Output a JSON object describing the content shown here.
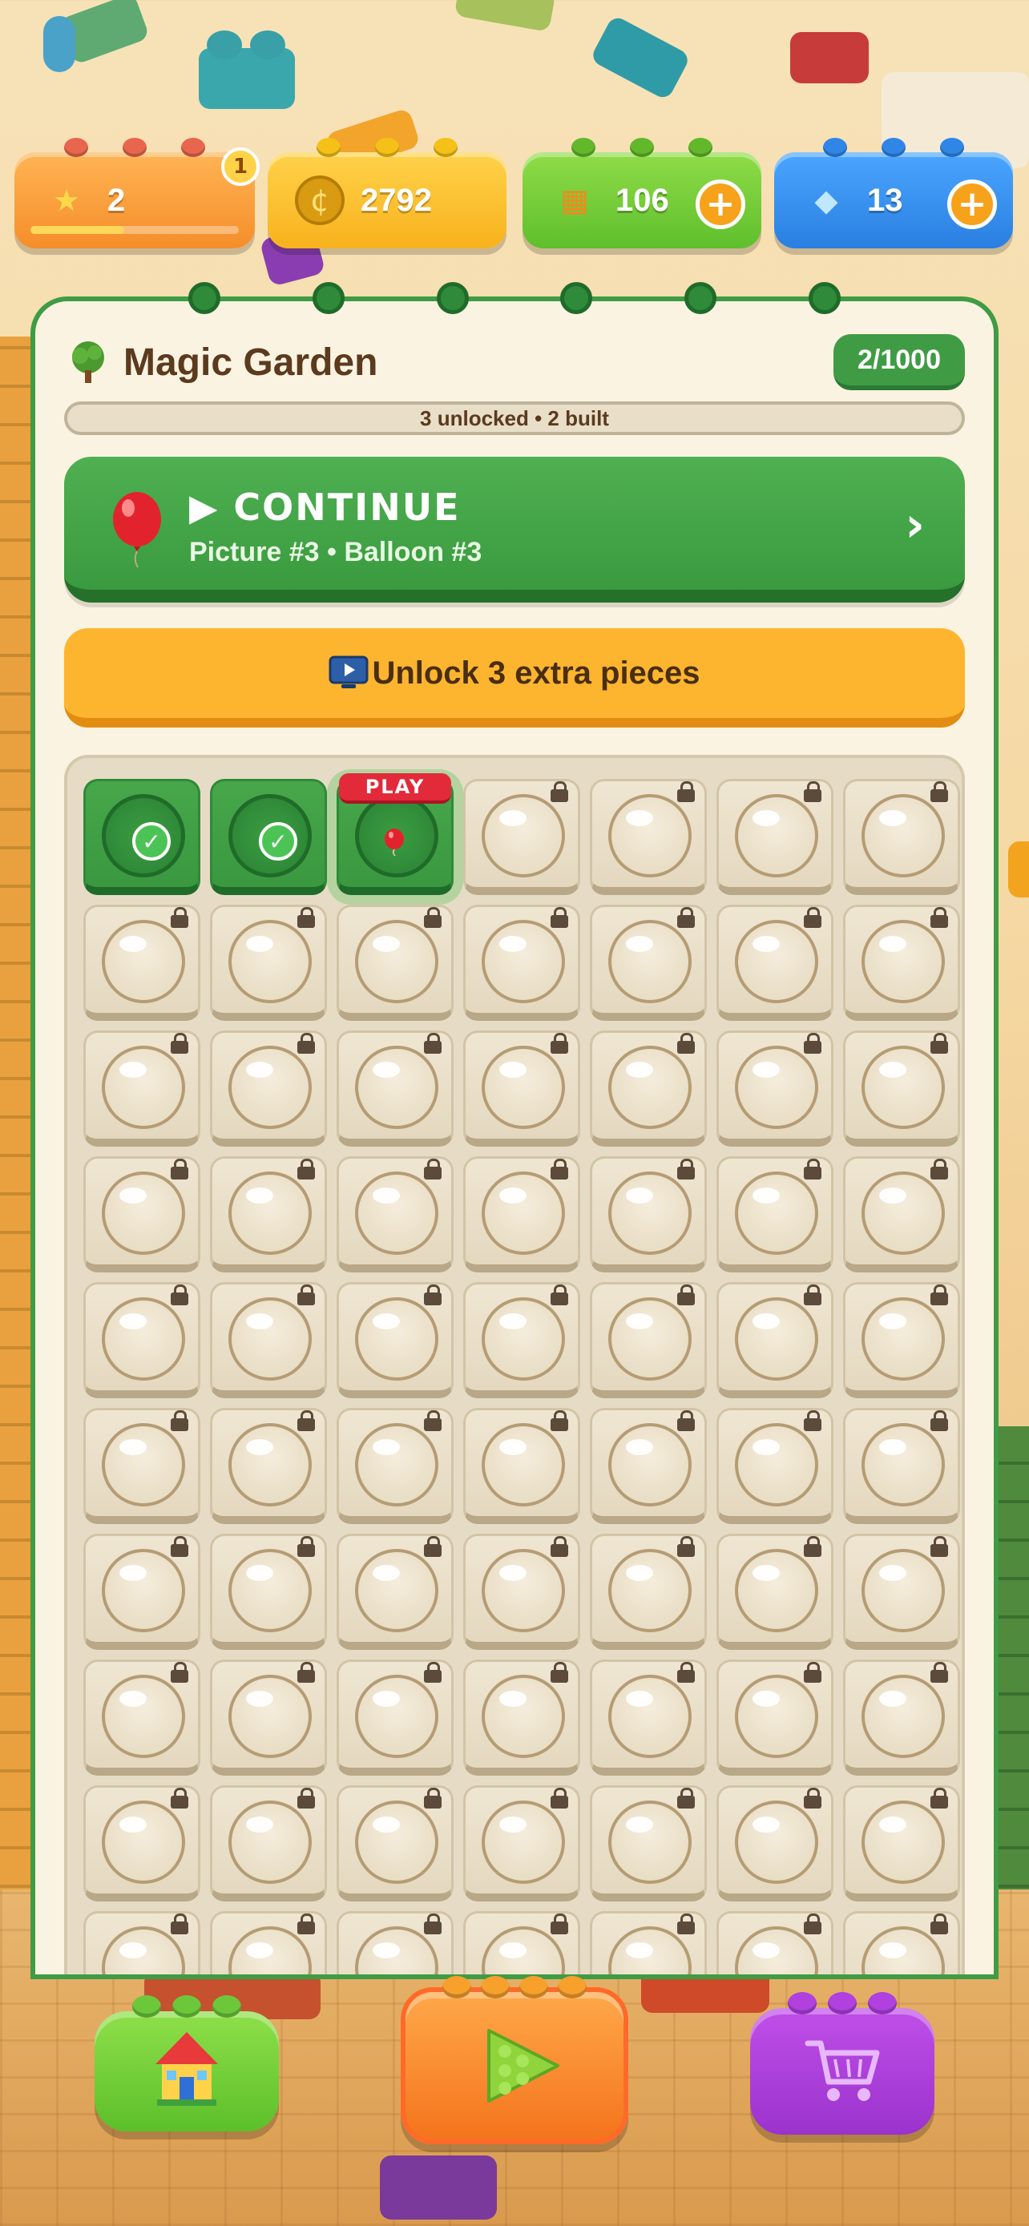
{
  "top_bar": {
    "stars": {
      "value": "2",
      "badge": "1",
      "progress": 0.45,
      "icon": "star-icon"
    },
    "coins": {
      "value": "2792",
      "icon": "coins-icon"
    },
    "bricks": {
      "value": "106",
      "icon": "bricks-icon",
      "plus": "+"
    },
    "gems": {
      "value": "13",
      "icon": "diamond-icon",
      "plus": "+"
    }
  },
  "panel": {
    "title": "Magic Garden",
    "icon": "tree-icon",
    "progress": "2/1000",
    "status": "3 unlocked • 2 built"
  },
  "continue": {
    "label": "▶ CONTINUE",
    "subtitle": "Picture #3 • Balloon #3",
    "chevron": "›"
  },
  "unlock": {
    "label": "Unlock 3 extra pieces",
    "icon": "tv-icon"
  },
  "grid": {
    "columns": 7,
    "visible_rows": 10,
    "completed": 2,
    "current_index": 2,
    "play_label": "PLAY"
  },
  "bottom_nav": [
    {
      "name": "home",
      "icon": "house-icon"
    },
    {
      "name": "play",
      "icon": "play-icon"
    },
    {
      "name": "shop",
      "icon": "cart-icon"
    }
  ],
  "colors": {
    "green": "#3f9c44",
    "orange": "#fdb52f",
    "red": "#e22a3a",
    "blue": "#3a8ee8",
    "purple": "#a13fd6"
  }
}
